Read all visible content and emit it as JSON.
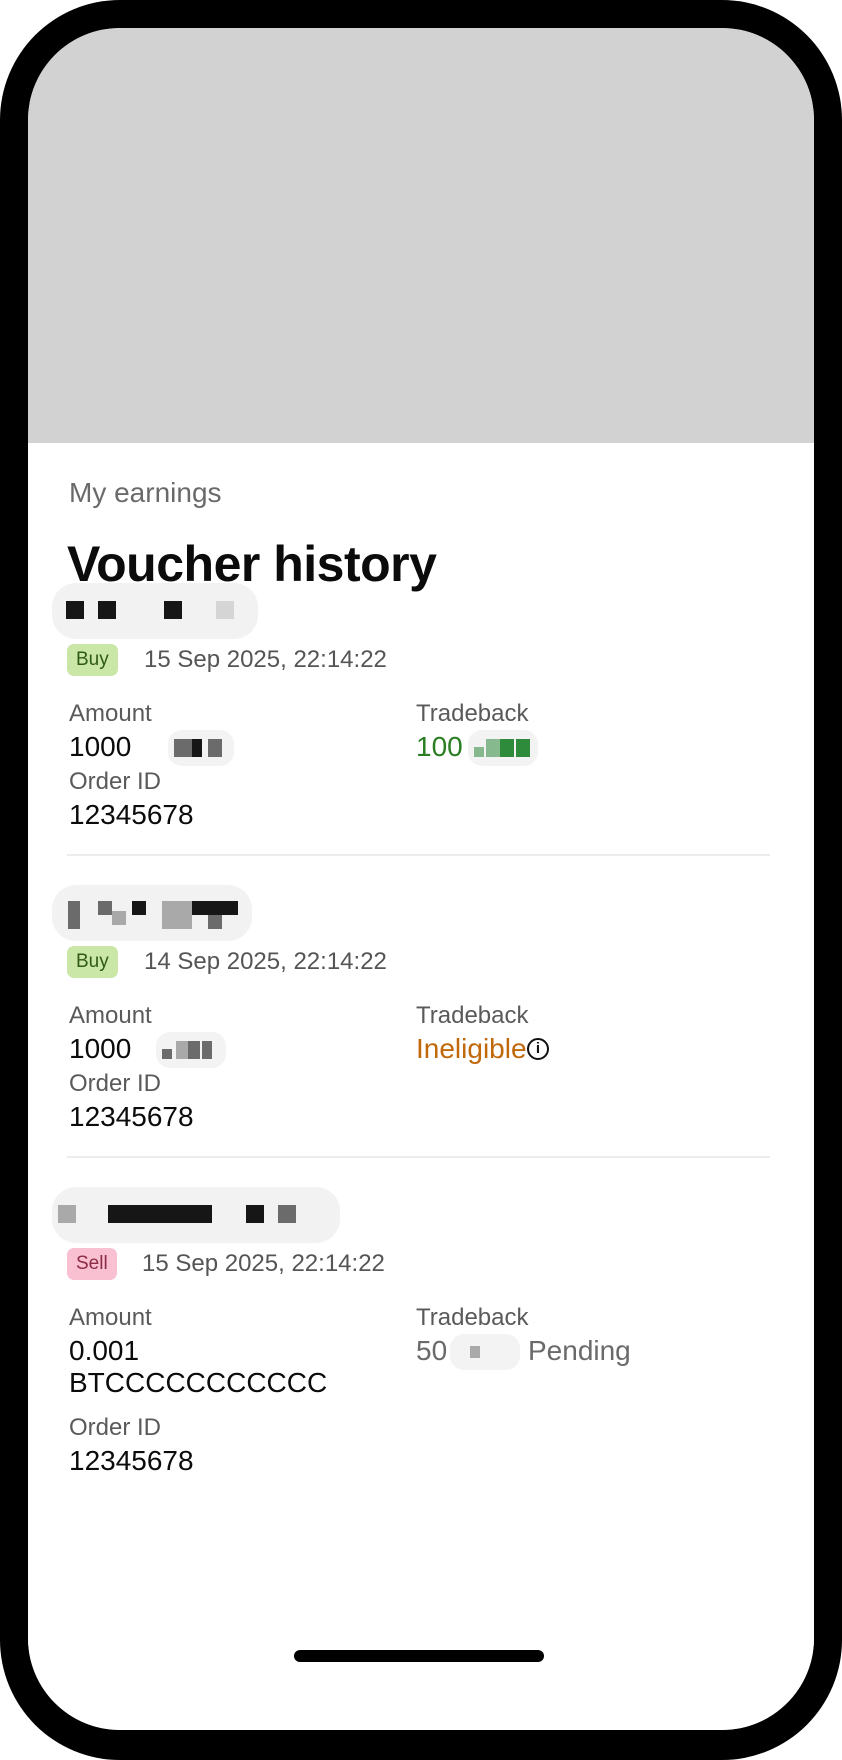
{
  "header": {
    "subtitle": "My earnings",
    "title": "Voucher history"
  },
  "vouchers": [
    {
      "type": "Buy",
      "date": "15 Sep 2025, 22:14:22",
      "amount_label": "Amount",
      "amount": "1000",
      "tradeback_label": "Tradeback",
      "tradeback": "100",
      "order_label": "Order ID",
      "order_id": "12345678"
    },
    {
      "type": "Buy",
      "date": "14 Sep 2025, 22:14:22",
      "amount_label": "Amount",
      "amount": "1000",
      "tradeback_label": "Tradeback",
      "tradeback": "Ineligible",
      "order_label": "Order ID",
      "order_id": "12345678"
    },
    {
      "type": "Sell",
      "date": "15 Sep 2025, 22:14:22",
      "amount_label": "Amount",
      "amount_line1": "0.001",
      "amount_line2": "BTCCCCCCCCCCC",
      "tradeback_label": "Tradeback",
      "tradeback": "50",
      "tradeback_status": "Pending",
      "order_label": "Order ID",
      "order_id": "12345678"
    }
  ],
  "colors": {
    "buy_badge": "#cbe7a8",
    "sell_badge": "#f8c0d1",
    "tradeback_positive": "#2a7d22",
    "tradeback_ineligible": "#c1680b"
  },
  "icons": {
    "info": "info-circle-icon"
  }
}
